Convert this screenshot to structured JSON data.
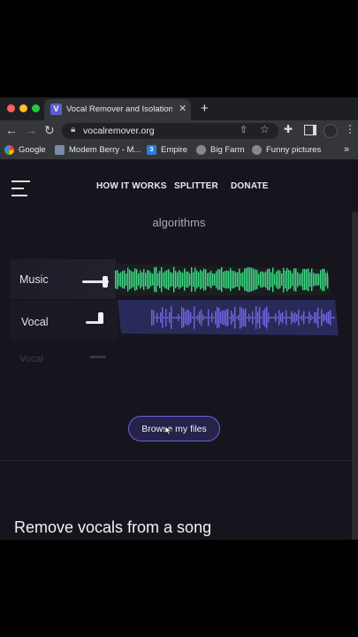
{
  "browser": {
    "tab_title": "Vocal Remover and Isolation [A",
    "tab_favicon": "V",
    "url": "vocalremover.org",
    "bookmarks": [
      {
        "label": "Google",
        "icon": "google-icon"
      },
      {
        "label": "Modem Berry - M...",
        "icon": "modem-icon"
      },
      {
        "label": "Empire",
        "icon": "empire-icon"
      },
      {
        "label": "Big Farm",
        "icon": "globe-icon"
      },
      {
        "label": "Funny pictures",
        "icon": "globe-icon"
      }
    ],
    "more_bookmarks": "»"
  },
  "nav": {
    "links": [
      "HOW IT WORKS",
      "SPLITTER",
      "DONATE"
    ]
  },
  "hero": {
    "subtitle": "algorithms"
  },
  "mixer": {
    "tracks": [
      {
        "label": "Music",
        "volume": 0.85,
        "color": "#3ddc84"
      },
      {
        "label": "Vocal",
        "volume": 0.7,
        "color": "#6f66e0"
      }
    ],
    "ghost_label": "Vocal"
  },
  "browse_button": "Browse my files",
  "section_title": "Remove vocals from a song",
  "colors": {
    "page_bg": "#16151d",
    "accent": "#6a5fd8",
    "music_wave": "#3ddc84",
    "vocal_wave": "#6f66e0"
  }
}
